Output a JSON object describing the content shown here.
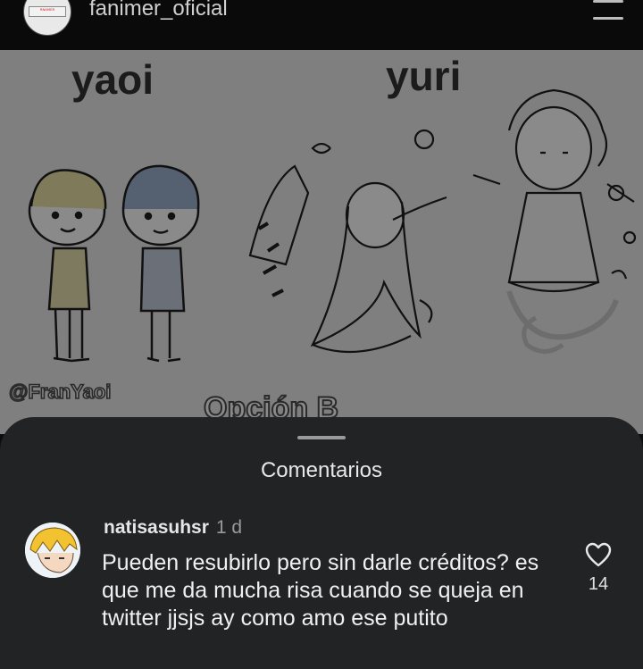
{
  "header": {
    "username": "fanimer_oficial",
    "avatar_text": "ᴿᴺᴬᴹᴱᴿ"
  },
  "post": {
    "label_left": "yaoi",
    "label_right": "yuri",
    "watermark_handle": "@FranYaoi",
    "watermark_option": "Opción B"
  },
  "comments_sheet": {
    "title": "Comentarios",
    "comment": {
      "username": "natisasuhsr",
      "time": "1 d",
      "text": "Pueden resubirlo pero sin darle créditos? es que me da mucha risa cuando se queja en twitter jjsjs ay como amo ese putito",
      "likes": "14"
    }
  }
}
